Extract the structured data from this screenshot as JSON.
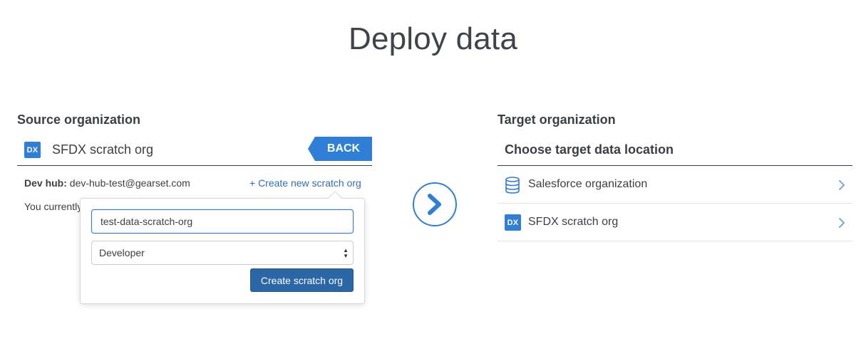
{
  "page": {
    "title": "Deploy data"
  },
  "source": {
    "heading": "Source organization",
    "org_badge": "DX",
    "org_name": "SFDX scratch org",
    "back_label": "BACK",
    "devhub_label": "Dev hub:",
    "devhub_value": "dev-hub-test@gearset.com",
    "create_link": "+ Create new scratch org",
    "current_text": "You currently"
  },
  "popover": {
    "org_name_value": "test-data-scratch-org",
    "edition_selected": "Developer",
    "create_button": "Create scratch org"
  },
  "target": {
    "heading": "Target organization",
    "subheading": "Choose target data location",
    "options": [
      {
        "label": "Salesforce organization",
        "icon": "database-icon"
      },
      {
        "label": "SFDX scratch org",
        "icon": "dx-icon",
        "badge": "DX"
      }
    ]
  },
  "colors": {
    "accent": "#2f7fd8",
    "button_dark": "#2b67a6",
    "link": "#2f6fb6",
    "text": "#3b3f45"
  }
}
